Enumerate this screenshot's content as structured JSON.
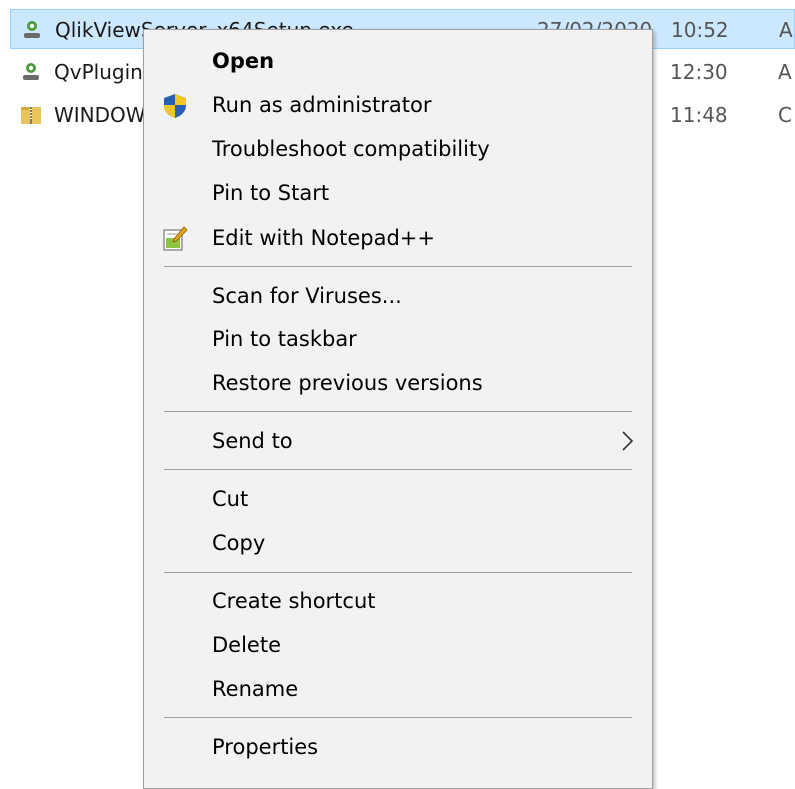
{
  "files": [
    {
      "name": "QlikViewServer_x64Setup.exe",
      "date": "27/02/2020",
      "time": "10:52",
      "type": "A",
      "icon": "qlik-app-icon",
      "selected": true
    },
    {
      "name": "QvPlugin",
      "date": "",
      "time": "12:30",
      "type": "A",
      "icon": "qlik-app-icon",
      "selected": false
    },
    {
      "name": "WINDOW",
      "date": "",
      "time": "11:48",
      "type": "C",
      "icon": "zip-folder-icon",
      "selected": false
    }
  ],
  "menu": {
    "open": "Open",
    "run_as_admin": "Run as administrator",
    "troubleshoot": "Troubleshoot compatibility",
    "pin_start": "Pin to Start",
    "edit_notepad": "Edit with Notepad++",
    "scan_viruses": "Scan for Viruses...",
    "pin_taskbar": "Pin to taskbar",
    "restore_versions": "Restore previous versions",
    "send_to": "Send to",
    "cut": "Cut",
    "copy": "Copy",
    "create_shortcut": "Create shortcut",
    "delete": "Delete",
    "rename": "Rename",
    "properties": "Properties"
  },
  "colors": {
    "selection_bg": "#cce8ff",
    "menu_bg": "#f2f2f2",
    "separator": "#a0a0a0"
  }
}
